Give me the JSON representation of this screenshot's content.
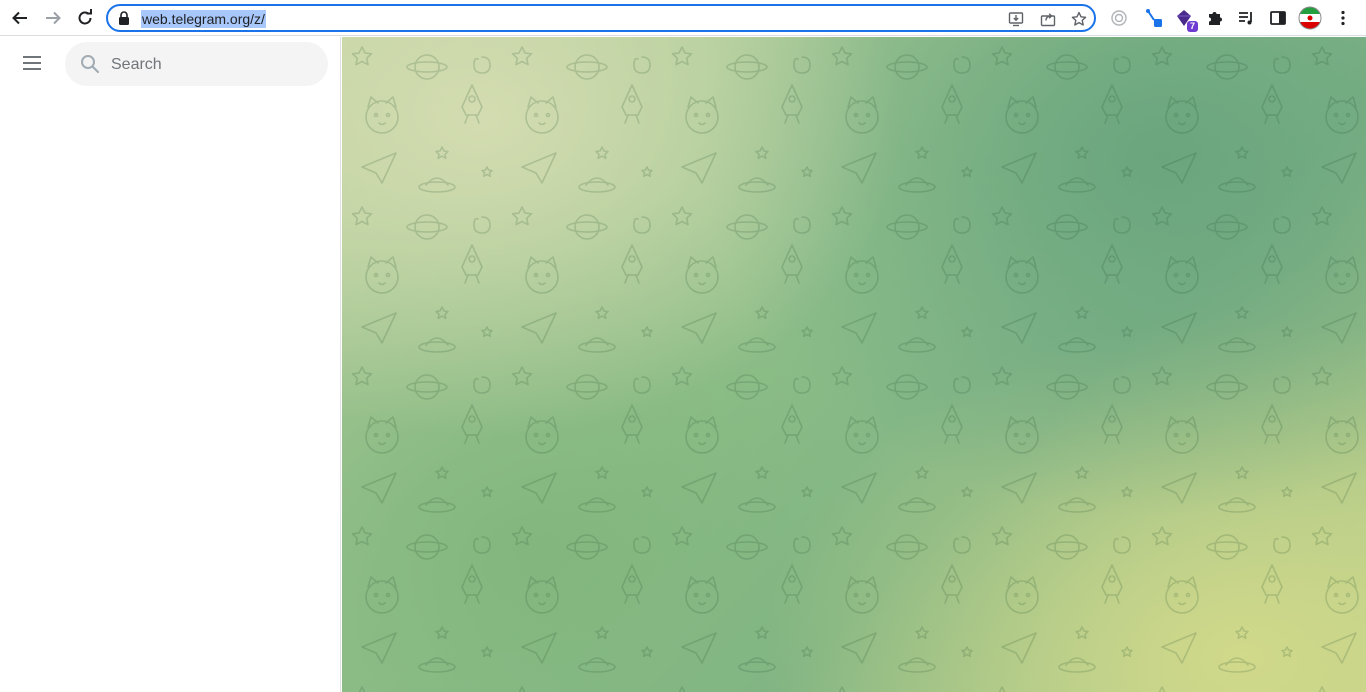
{
  "browser": {
    "url": "web.telegram.org/z/",
    "extension_badge": "7"
  },
  "sidebar": {
    "search": {
      "placeholder": "Search",
      "value": ""
    }
  },
  "icons": {
    "back": "arrow-left-icon",
    "forward": "arrow-right-icon",
    "reload": "reload-icon",
    "lock": "lock-icon",
    "install": "install-app-icon",
    "share": "share-icon",
    "bookmark": "star-icon",
    "menu": "hamburger-icon",
    "search": "search-icon"
  },
  "colors": {
    "accent": "#1a73e8",
    "url_highlight": "#a8c7fa",
    "search_bg": "#f4f4f5"
  }
}
